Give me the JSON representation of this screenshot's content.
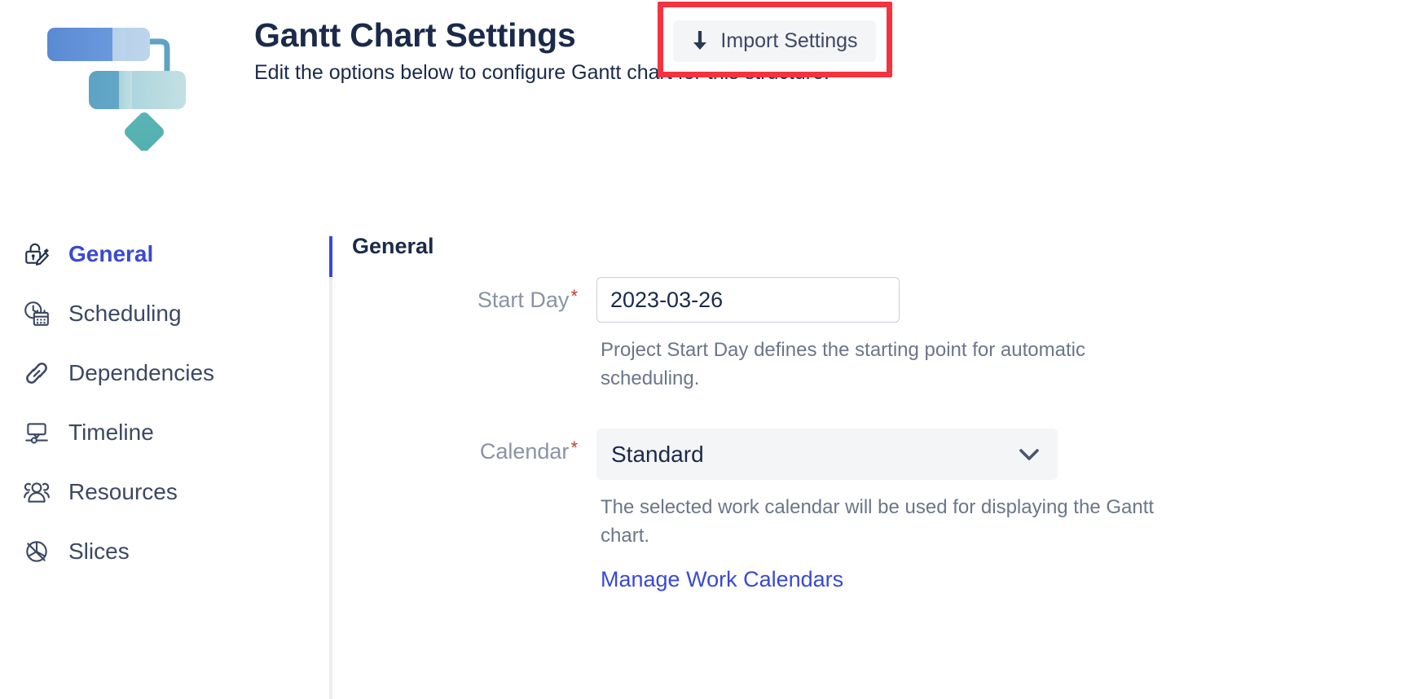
{
  "header": {
    "logo_name": "gantt-chart-logo",
    "title": "Gantt Chart Settings",
    "subtitle": "Edit the options below to configure Gantt chart for this structure.",
    "import_button_label": "Import Settings",
    "import_button_icon": "download-arrow-icon",
    "highlight_color": "#f5333f"
  },
  "nav": {
    "items": [
      {
        "label": "General",
        "icon": "lock-edit-icon",
        "active": true
      },
      {
        "label": "Scheduling",
        "icon": "clock-calendar-icon",
        "active": false
      },
      {
        "label": "Dependencies",
        "icon": "link-chain-icon",
        "active": false
      },
      {
        "label": "Timeline",
        "icon": "timeline-icon",
        "active": false
      },
      {
        "label": "Resources",
        "icon": "people-group-icon",
        "active": false
      },
      {
        "label": "Slices",
        "icon": "pie-slice-icon",
        "active": false
      }
    ],
    "active_color": "#3949d4"
  },
  "panel": {
    "section_title": "General",
    "fields": {
      "start_day": {
        "label": "Start Day",
        "required_marker": "*",
        "value": "2023-03-26",
        "placeholder": "",
        "help": "Project Start Day defines the starting point for automatic scheduling."
      },
      "calendar": {
        "label": "Calendar",
        "required_marker": "*",
        "value": "Standard",
        "options": [
          "Standard"
        ],
        "help": "The selected work calendar will be used for displaying the Gantt chart.",
        "link_label": "Manage Work Calendars",
        "chevron_icon": "chevron-down-icon"
      }
    }
  }
}
